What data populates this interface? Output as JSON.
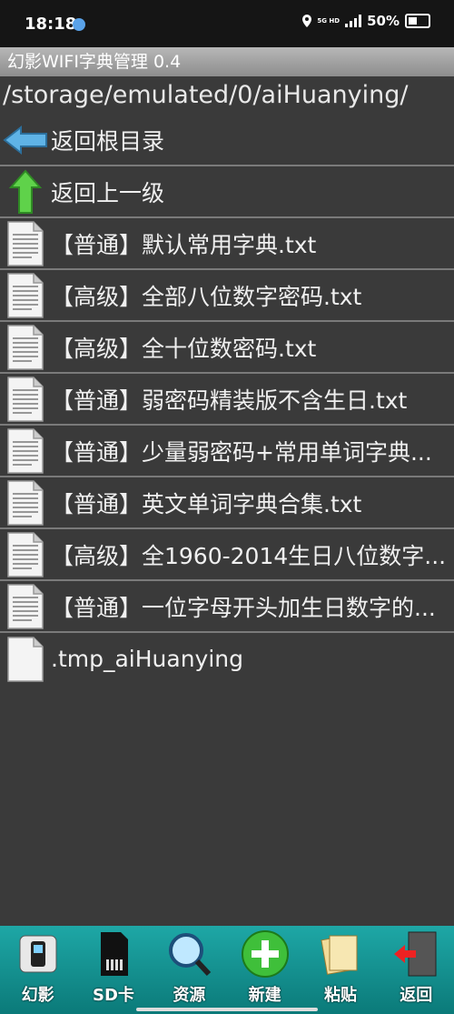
{
  "status": {
    "time": "18:18",
    "network": "5G HD",
    "battery": "50%"
  },
  "app": {
    "title": "幻影WIFI字典管理 0.4"
  },
  "path": "/storage/emulated/0/aiHuanying/",
  "nav": {
    "root_label": "返回根目录",
    "up_label": "返回上一级"
  },
  "files": [
    {
      "name": "【普通】默认常用字典.txt",
      "icon": "text-file-icon"
    },
    {
      "name": "【高级】全部八位数字密码.txt",
      "icon": "text-file-icon"
    },
    {
      "name": "【高级】全十位数密码.txt",
      "icon": "text-file-icon"
    },
    {
      "name": "【普通】弱密码精装版不含生日.txt",
      "icon": "text-file-icon"
    },
    {
      "name": "【普通】少量弱密码+常用单词字典...",
      "icon": "text-file-icon"
    },
    {
      "name": "【普通】英文单词字典合集.txt",
      "icon": "text-file-icon"
    },
    {
      "name": "【高级】全1960-2014生日八位数字...",
      "icon": "text-file-icon"
    },
    {
      "name": "【普通】一位字母开头加生日数字的...",
      "icon": "text-file-icon"
    },
    {
      "name": ".tmp_aiHuanying",
      "icon": "blank-file-icon"
    }
  ],
  "toolbar": [
    {
      "label": "幻影",
      "icon": "phone-icon"
    },
    {
      "label": "SD卡",
      "icon": "sd-card-icon"
    },
    {
      "label": "资源",
      "icon": "magnifier-icon"
    },
    {
      "label": "新建",
      "icon": "plus-icon"
    },
    {
      "label": "粘贴",
      "icon": "paste-icon"
    },
    {
      "label": "返回",
      "icon": "exit-icon"
    }
  ],
  "colors": {
    "toolbar": "#129a99",
    "background": "#3a3a3a",
    "title_bar": "#a6a6a6"
  }
}
